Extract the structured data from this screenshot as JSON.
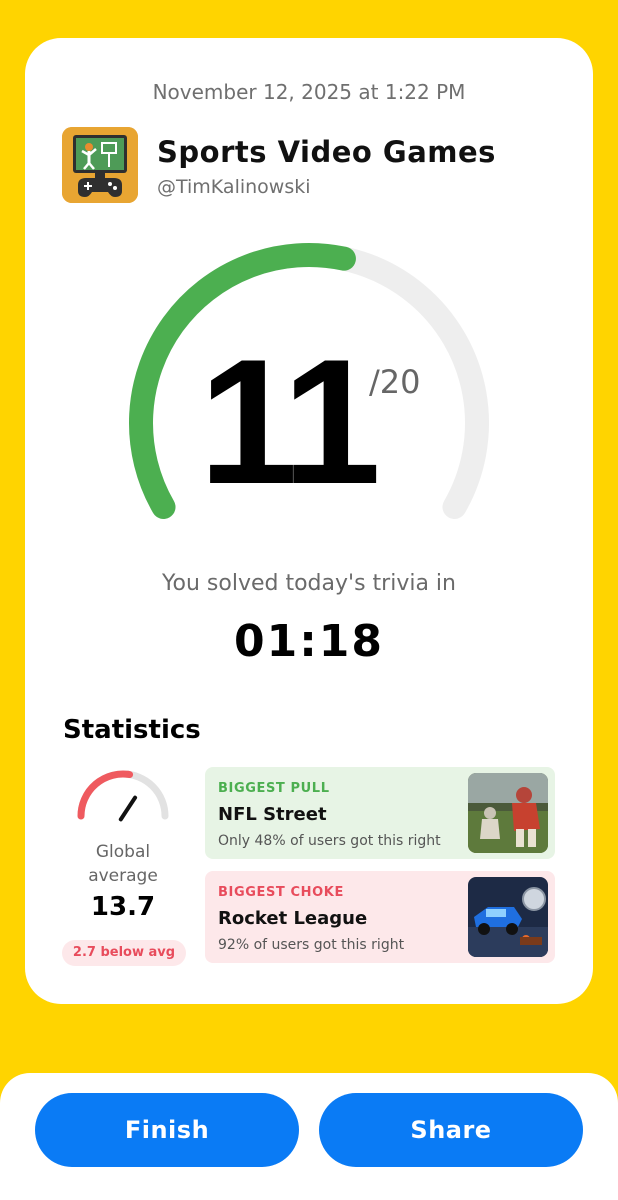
{
  "card": {
    "timestamp": "November 12, 2025 at 1:22 PM",
    "quiz_title": "Sports Video Games",
    "quiz_author": "@TimKalinowski",
    "quiz_icon": "sports-video-games-icon"
  },
  "result": {
    "score": "11",
    "max": "/20",
    "score_fraction": 0.55,
    "solved_label": "You solved today's trivia in",
    "solved_time": "01:18"
  },
  "statistics": {
    "title": "Statistics",
    "global_label": "Global average",
    "global_value": "13.7",
    "global_fraction": 0.685,
    "below_badge": "2.7 below avg",
    "biggest_pull": {
      "kicker": "BIGGEST PULL",
      "name": "NFL Street",
      "desc": "Only 48% of users got this right",
      "thumb": "nfl-street-thumbnail"
    },
    "biggest_choke": {
      "kicker": "BIGGEST CHOKE",
      "name": "Rocket League",
      "desc": "92% of users got this right",
      "thumb": "rocket-league-thumbnail"
    }
  },
  "actions": {
    "finish_label": "Finish",
    "share_label": "Share"
  },
  "colors": {
    "background": "#FFD400",
    "progress": "#4CAF50",
    "track": "#EEEEEE",
    "button": "#0A7BF5",
    "negative": "#E84C5C"
  }
}
